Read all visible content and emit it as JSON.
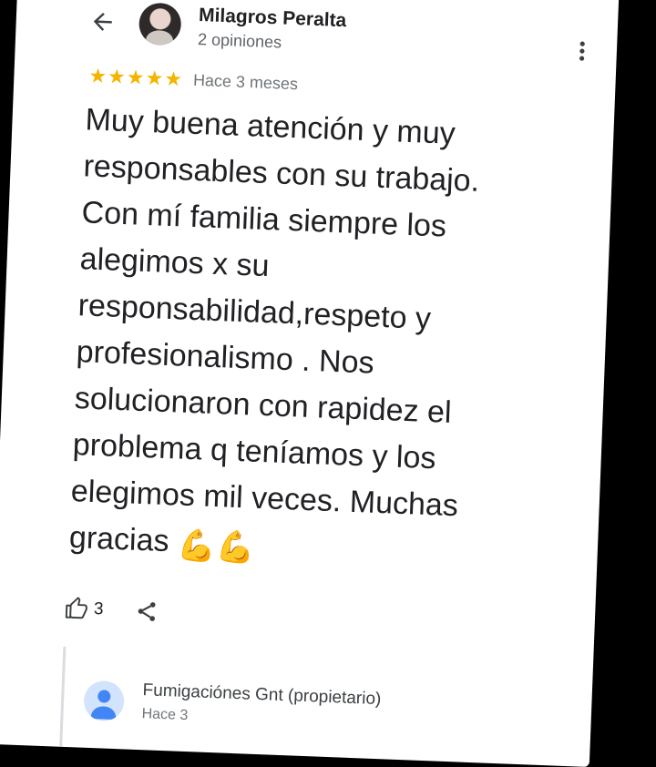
{
  "review": {
    "author_name": "Milagros Peralta",
    "author_reviews": "2 opiniones",
    "rating": 5,
    "stars": [
      "★",
      "★",
      "★",
      "★",
      "★"
    ],
    "time": "Hace 3 meses",
    "text": "Muy buena atención y muy responsables con su trabajo. Con mí familia siempre los alegimos x su responsabilidad,respeto y profesionalismo . Nos solucionaron con rapidez el problema q teníamos y los elegimos mil veces. Muchas gracias",
    "emojis": "💪💪",
    "like_count": "3"
  },
  "owner_reply": {
    "author": "Fumigaciónes Gnt (propietario)",
    "time": "Hace 3"
  },
  "icons": {
    "back": "arrow-back-icon",
    "more": "more-vert-icon",
    "like": "thumb-up-icon",
    "share": "share-icon",
    "emoji": "flexed-biceps-emoji"
  },
  "colors": {
    "star": "#f4b400",
    "text": "#202124",
    "secondary": "#5f6368",
    "owner_avatar": "#d2e3fc",
    "owner_avatar_fg": "#4285f4"
  }
}
